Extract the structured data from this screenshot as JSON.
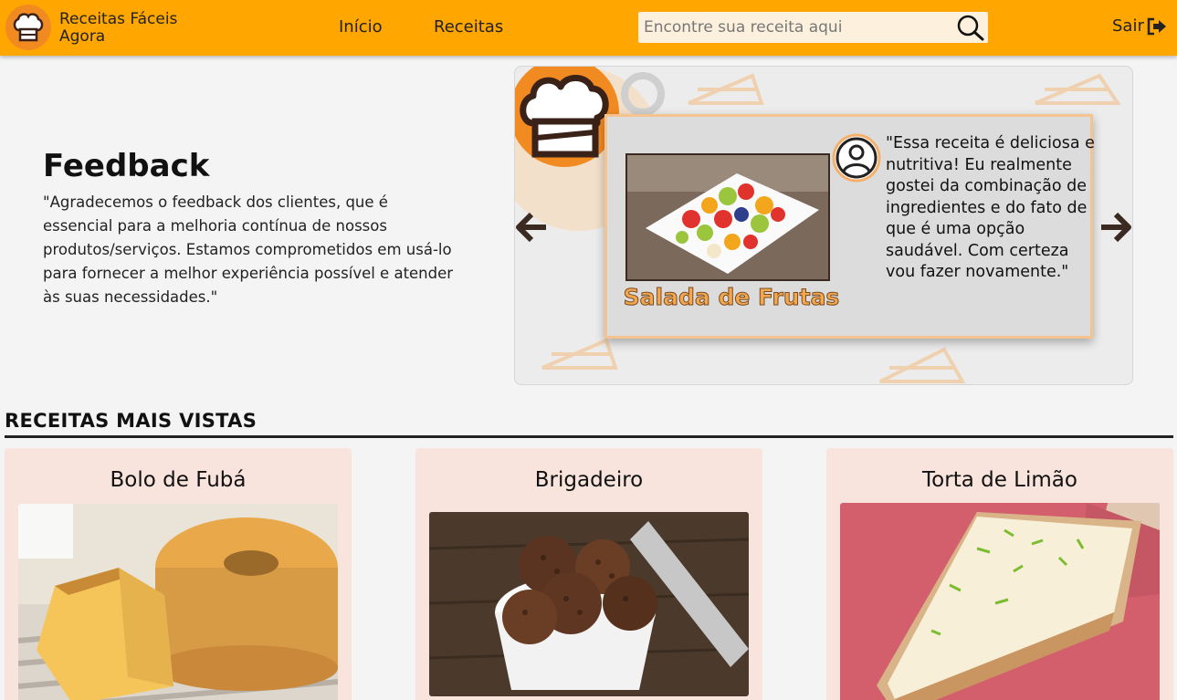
{
  "header": {
    "brand_line1": "Receitas Fáceis",
    "brand_line2": "Agora",
    "nav": [
      {
        "label": "Início"
      },
      {
        "label": "Receitas"
      }
    ],
    "search": {
      "placeholder": "Encontre sua receita aqui",
      "value": ""
    },
    "logout_label": "Sair",
    "accent_color": "#ffa600"
  },
  "feedback": {
    "title": "Feedback",
    "text": "\"Agradecemos o feedback dos clientes, que é essencial para a melhoria contínua de nossos produtos/serviços. Estamos comprometidos em usá-lo para fornecer a melhor experiência possível e atender às suas necessidades.\""
  },
  "carousel": {
    "recipe_name": "Salada de Frutas",
    "quote": "\"Essa receita é deliciosa e nutritiva! Eu realmente gostei da combinação de ingredientes e do fato de que é uma opção saudável. Com certeza vou fazer novamente.\""
  },
  "most_viewed": {
    "title": "RECEITAS MAIS VISTAS",
    "recipes": [
      {
        "name": "Bolo de Fubá"
      },
      {
        "name": "Brigadeiro"
      },
      {
        "name": "Torta de Limão"
      }
    ]
  }
}
